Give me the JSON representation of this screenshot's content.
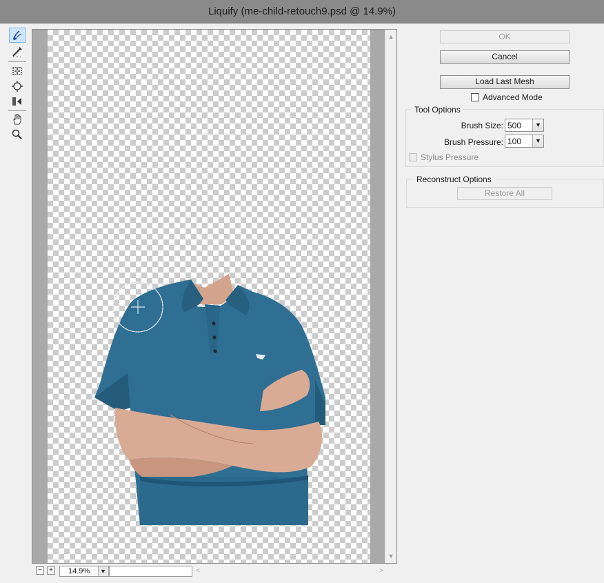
{
  "window": {
    "title": "Liquify (me-child-retouch9.psd @ 14.9%)"
  },
  "tools": [
    {
      "name": "forward-warp-tool",
      "icon": "warp-hand-icon",
      "active": true
    },
    {
      "name": "reconstruct-tool",
      "icon": "reconstruct-brush-icon",
      "active": false
    },
    {
      "name": "pucker-tool",
      "icon": "pucker-icon",
      "active": false
    },
    {
      "name": "bloat-tool",
      "icon": "bloat-icon",
      "active": false
    },
    {
      "name": "push-left-tool",
      "icon": "push-left-icon",
      "active": false
    },
    {
      "name": "hand-tool",
      "icon": "hand-icon",
      "active": false
    },
    {
      "name": "zoom-tool",
      "icon": "magnifier-icon",
      "active": false
    }
  ],
  "status": {
    "zoom_out": "−",
    "zoom_in": "+",
    "zoom_value": "14.9%"
  },
  "buttons": {
    "ok": "OK",
    "cancel": "Cancel",
    "load_last_mesh": "Load Last Mesh",
    "restore_all": "Restore All"
  },
  "advanced_mode": {
    "label": "Advanced Mode",
    "checked": false
  },
  "tool_options": {
    "title": "Tool Options",
    "brush_size_label": "Brush Size:",
    "brush_size_value": "500",
    "brush_pressure_label": "Brush Pressure:",
    "brush_pressure_value": "100",
    "stylus_pressure_label": "Stylus Pressure"
  },
  "reconstruct_options": {
    "title": "Reconstruct Options"
  },
  "colors": {
    "shirt": "#2f6f93",
    "shirt_dark": "#1f5677",
    "skin": "#d9ab95",
    "active_tool": "#cfe6fa"
  }
}
